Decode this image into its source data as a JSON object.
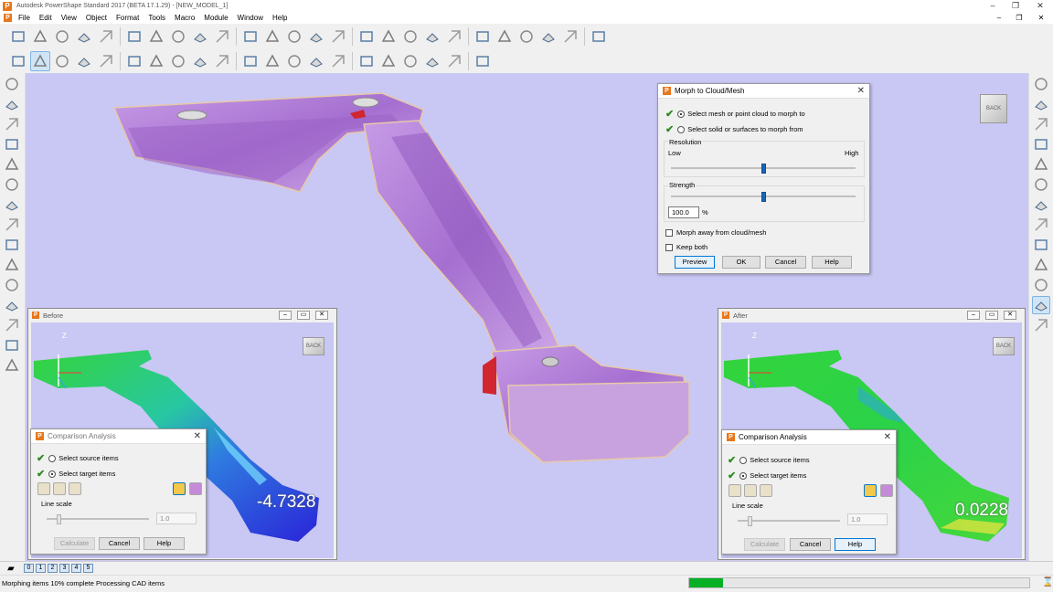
{
  "window": {
    "title": "Autodesk PowerShape Standard 2017 (BETA 17.1.29) - [NEW_MODEL_1]"
  },
  "menu": [
    "File",
    "Edit",
    "View",
    "Object",
    "Format",
    "Tools",
    "Macro",
    "Module",
    "Window",
    "Help"
  ],
  "toolbar1": [
    "select-icon",
    "open-icon",
    "open-model-icon",
    "save-icon",
    "print-icon",
    "cut-icon",
    "copy-icon",
    "paste-icon",
    "edit-icon",
    "delete-icon",
    "undo-icon",
    "redo-icon",
    "pen-icon",
    "hand-icon",
    "point-icon",
    "workplane-icon",
    "line-icon",
    "arc-icon",
    "curve-icon",
    "text-icon",
    "surface-icon",
    "solid-icon",
    "mesh-icon",
    "feature-icon",
    "spark-icon",
    "drawing-icon"
  ],
  "toolbar2": [
    "cube-select-icon",
    "view-select-icon",
    "shade-icon",
    "shade2-icon",
    "flat-icon",
    "edge-icon",
    "hidden-icon",
    "view-top-icon",
    "view-front-icon",
    "view-right-icon",
    "view-iso-icon",
    "view-iso2-icon",
    "view-iso3-icon",
    "view-iso4-icon",
    "view-iso5-icon",
    "view-iso6-icon",
    "view-iso7-icon",
    "view-iso8-icon",
    "layer-icon",
    "layer2-icon",
    "layer3-icon"
  ],
  "morph": {
    "title": "Morph to Cloud/Mesh",
    "option1": "Select mesh or point cloud to morph to",
    "option2": "Select solid or surfaces to morph from",
    "resolution_label": "Resolution",
    "low": "Low",
    "high": "High",
    "strength_label": "Strength",
    "strength_value": "100.0",
    "percent": "%",
    "morph_away": "Morph away from cloud/mesh",
    "keep_both": "Keep both",
    "preview": "Preview",
    "ok": "OK",
    "cancel": "Cancel",
    "help": "Help",
    "resolution_level": 0.5,
    "strength_level": 0.5
  },
  "before": {
    "title": "Before",
    "readout": "-4.7328",
    "axis": "Z",
    "cube": "BACK",
    "analysis": {
      "title": "Comparison Analysis",
      "source": "Select source items",
      "target": "Select target items",
      "line_scale": "Line scale",
      "value": "1.0",
      "calculate": "Calculate",
      "cancel": "Cancel",
      "help": "Help"
    }
  },
  "after": {
    "title": "After",
    "readout": "0.0228",
    "axis": "Z",
    "cube": "BACK",
    "analysis": {
      "title": "Comparison Analysis",
      "source": "Select source items",
      "target": "Select target items",
      "line_scale": "Line scale",
      "value": "1.0",
      "calculate": "Calculate",
      "cancel": "Cancel",
      "help": "Help"
    }
  },
  "viewcube": "BACK",
  "status": {
    "tabs": [
      "0",
      "1",
      "2",
      "3",
      "4",
      "5"
    ],
    "message": "Morphing items  10% complete Processing CAD items",
    "progress": 0.1
  },
  "colors": {
    "viewport": "#c9c7f4",
    "part": "#b67fd6",
    "accent": "#1766b8",
    "check": "#2e8b22"
  }
}
